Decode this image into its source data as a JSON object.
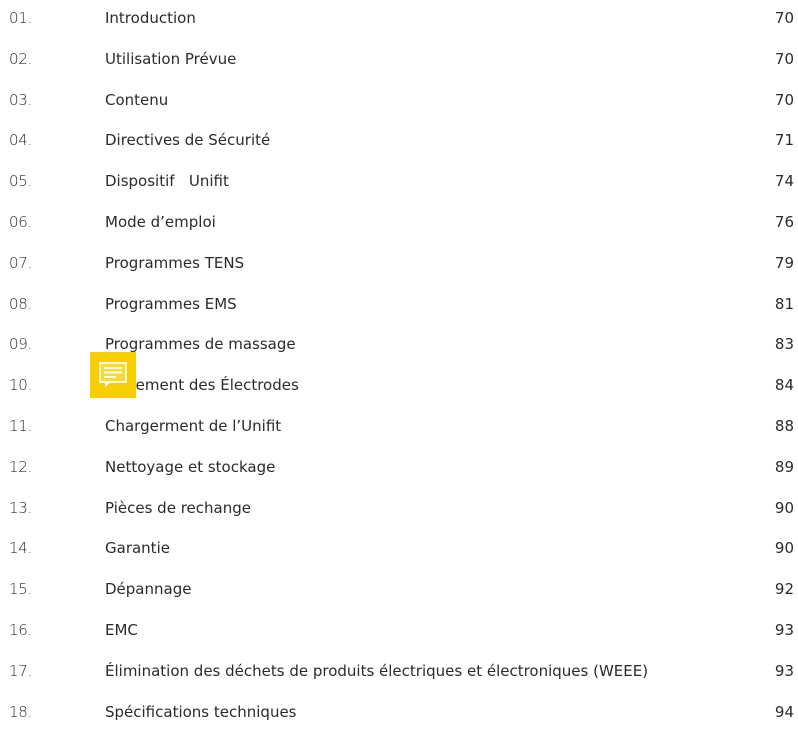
{
  "toc": {
    "entries": [
      {
        "num": "01.",
        "title": "Introduction",
        "page": "70"
      },
      {
        "num": "02.",
        "title": "Utilisation Prévue",
        "page": "70"
      },
      {
        "num": "03.",
        "title": "Contenu",
        "page": "70"
      },
      {
        "num": "04.",
        "title": "Directives de Sécurité",
        "page": "71"
      },
      {
        "num": "05.",
        "title": "Dispositif   Unifit",
        "page": "74"
      },
      {
        "num": "06.",
        "title": "Mode d’emploi",
        "page": "76"
      },
      {
        "num": "07.",
        "title": "Programmes TENS",
        "page": "79"
      },
      {
        "num": "08.",
        "title": "Programmes EMS",
        "page": "81"
      },
      {
        "num": "09.",
        "title": "Programmes de massage",
        "page": "83"
      },
      {
        "num": "10.",
        "title": "Placement des Électrodes",
        "page": "84"
      },
      {
        "num": "11.",
        "title": "Chargerment de l’Unifit",
        "page": "88"
      },
      {
        "num": "12.",
        "title": "Nettoyage et stockage",
        "page": "89"
      },
      {
        "num": "13.",
        "title": "Pièces de rechange",
        "page": "90"
      },
      {
        "num": "14.",
        "title": "Garantie",
        "page": "90"
      },
      {
        "num": "15.",
        "title": "Dépannage",
        "page": "92"
      },
      {
        "num": "16.",
        "title": "EMC",
        "page": "93"
      },
      {
        "num": "17.",
        "title": "Élimination des déchets de produits électriques et électroniques (WEEE)",
        "page": "93"
      },
      {
        "num": "18.",
        "title": "Spécifications techniques",
        "page": "94"
      }
    ]
  },
  "annotation": {
    "icon": "comment-note-icon",
    "color": "#f7cf00"
  },
  "colors": {
    "text": "#2b2b2b",
    "background": "#ffffff"
  }
}
